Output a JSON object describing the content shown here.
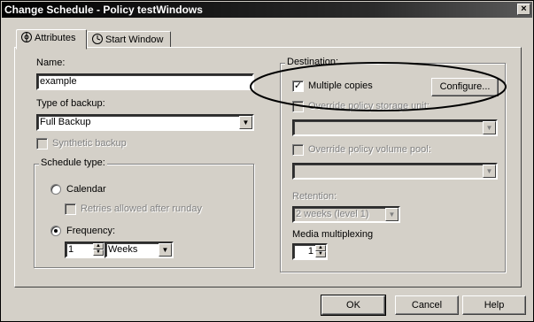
{
  "window": {
    "title": "Change Schedule - Policy testWindows",
    "close_glyph": "×"
  },
  "tabs": [
    {
      "label": "Attributes",
      "icon": "attributes-icon"
    },
    {
      "label": "Start Window",
      "icon": "clock-icon"
    }
  ],
  "left": {
    "name_label": "Name:",
    "name_value": "example",
    "type_label": "Type of backup:",
    "type_value": "Full Backup",
    "synthetic_label": "Synthetic backup",
    "schedule_type": {
      "label": "Schedule type:",
      "calendar_label": "Calendar",
      "retries_label": "Retries allowed after runday",
      "frequency_label": "Frequency:",
      "frequency_value": "1",
      "frequency_unit": "Weeks"
    }
  },
  "right": {
    "destination_label": "Destination:",
    "multiple_copies_label": "Multiple copies",
    "configure_label": "Configure...",
    "override_storage_label": "Override policy storage unit:",
    "override_volume_label": "Override policy volume pool:",
    "retention_label": "Retention:",
    "retention_value": "2 weeks (level 1)",
    "media_mux_label": "Media multiplexing",
    "media_mux_value": "1"
  },
  "footer": {
    "ok_label": "OK",
    "cancel_label": "Cancel",
    "help_label": "Help"
  },
  "states": {
    "multiple_copies_checked": true,
    "frequency_selected": true
  },
  "colors": {
    "dialog_bg": "#d4d0c8",
    "titlebar": "#000000",
    "disabled_text": "#808080"
  }
}
